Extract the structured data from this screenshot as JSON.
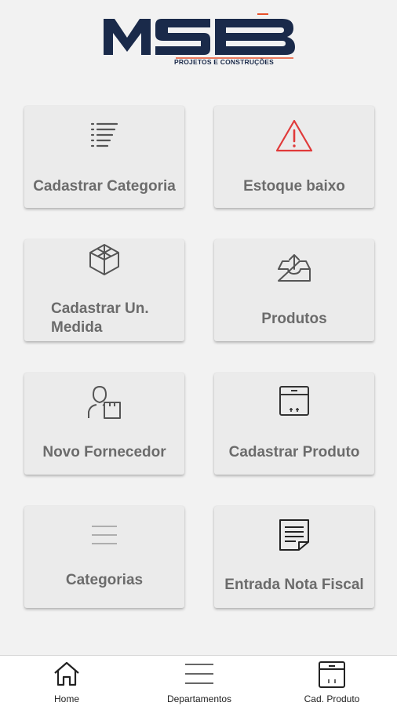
{
  "header": {
    "logo_text": "MSB",
    "logo_subtitle": "PROJETOS E CONSTRUÇÕES",
    "colors": {
      "navy": "#1a2a4a",
      "accent": "#e8502a"
    }
  },
  "menu": [
    {
      "label": "Cadastrar Categoria",
      "icon": "list-icon"
    },
    {
      "label": "Estoque baixo",
      "icon": "warning-icon"
    },
    {
      "label": "Cadastrar Un. Medida",
      "icon": "cube-icon"
    },
    {
      "label": "Produtos",
      "icon": "inbox-upload-icon"
    },
    {
      "label": "Novo Fornecedor",
      "icon": "supplier-icon"
    },
    {
      "label": "Cadastrar Produto",
      "icon": "box-icon"
    },
    {
      "label": "Categorias",
      "icon": "menu-lines-icon"
    },
    {
      "label": "Entrada Nota Fiscal",
      "icon": "document-icon"
    }
  ],
  "bottom_nav": [
    {
      "label": "Home",
      "icon": "home-icon"
    },
    {
      "label": "Departamentos",
      "icon": "menu-icon"
    },
    {
      "label": "Cad. Produto",
      "icon": "box-icon"
    }
  ]
}
